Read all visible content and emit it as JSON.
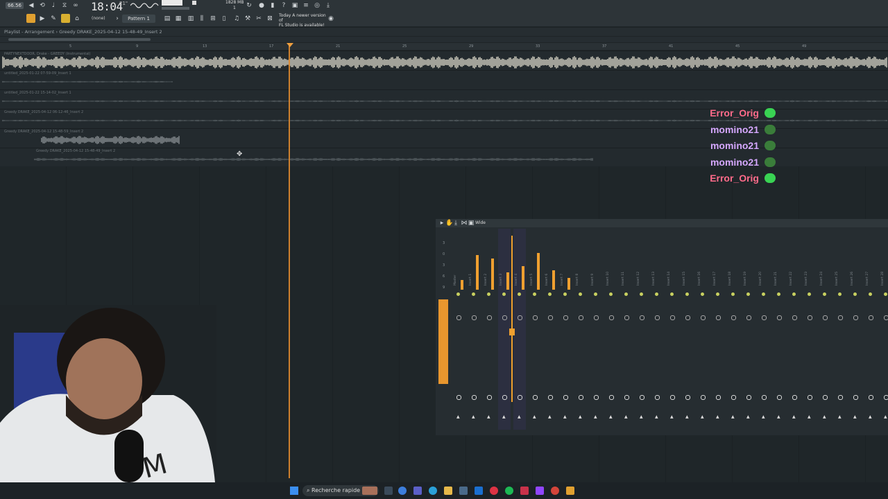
{
  "toolbar": {
    "cpu": "66.56",
    "clock": "18:04",
    "clock_sub": "21\"",
    "memory": "1828 MB",
    "memory_sub": "1",
    "pattern": "Pattern 1",
    "none": "(none)",
    "update_notice_line1": "Today  A newer version of",
    "update_notice_line2": "FL Studio is available!"
  },
  "playlist": {
    "title": "Playlist - Arrangement › Greedy DRAKE_2025-04-12 15-48-49_Insert 2",
    "ticks": [
      "5",
      "9",
      "13",
      "17",
      "21",
      "25",
      "29",
      "33",
      "37",
      "41",
      "45",
      "49"
    ],
    "tracks": [
      {
        "label": "PARTYNEXTDOOR, Drake - GREEDY (Instrumental)"
      },
      {
        "label": "untitled_2025-01-22 07-59-09_Insert 1"
      },
      {
        "label": "untitled_2025-01-22 15-14-02_Insert 1"
      },
      {
        "label": "Greedy DRAKE_2025-04-12 06-12-46_Insert 2"
      },
      {
        "label": "Greedy DRAKE_2025-04-12 15-48-59_Insert 2"
      },
      {
        "label": "Greedy DRAKE_2025-04-12 15-48-49_Insert 2"
      }
    ]
  },
  "chat": [
    {
      "user": "Error_Orig",
      "color": "#ff6b8a",
      "emote_color": "#39d353"
    },
    {
      "user": "momino21",
      "color": "#d6a8ff",
      "emote_color": "#3a7d3a"
    },
    {
      "user": "momino21",
      "color": "#d6a8ff",
      "emote_color": "#3a7d3a"
    },
    {
      "user": "momino21",
      "color": "#d6a8ff",
      "emote_color": "#3a7d3a"
    },
    {
      "user": "Error_Orig",
      "color": "#ff6b8a",
      "emote_color": "#39d353"
    }
  ],
  "mixer": {
    "title": "Wide",
    "accent": "#f0a030",
    "strips": [
      "Master",
      "Insert 1",
      "Insert 2",
      "Insert 3",
      "Insert 4",
      "Insert 5",
      "Insert 6",
      "Insert 7",
      "Insert 8",
      "Insert 9",
      "Insert 10",
      "Insert 11",
      "Insert 12",
      "Insert 13",
      "Insert 14",
      "Insert 15",
      "Insert 16",
      "Insert 17",
      "Insert 18",
      "Insert 19",
      "Insert 20",
      "Insert 21",
      "Insert 22",
      "Insert 23",
      "Insert 24",
      "Insert 25",
      "Insert 26",
      "Insert 27",
      "Insert 28",
      "Insert 29"
    ],
    "scale": [
      "3",
      "0",
      "3",
      "6",
      "9"
    ]
  },
  "taskbar": {
    "search": "Recherche rapide"
  },
  "colors": {
    "playhead": "#e08a2e",
    "waveform": "#d9d6c8"
  }
}
